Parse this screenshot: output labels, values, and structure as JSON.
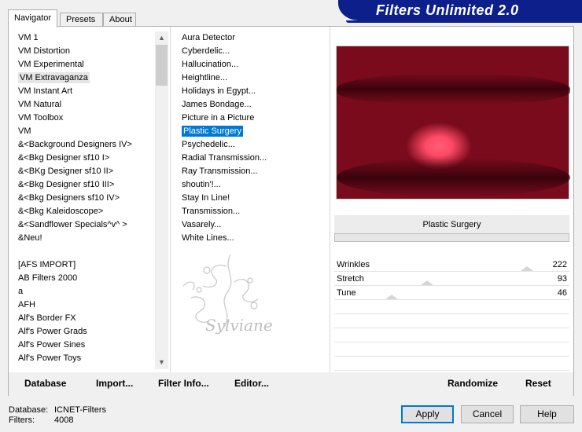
{
  "banner": {
    "title": "Filters Unlimited 2.0"
  },
  "tabs": {
    "navigator": "Navigator",
    "presets": "Presets",
    "about": "About"
  },
  "categories": [
    "VM 1",
    "VM Distortion",
    "VM Experimental",
    "VM Extravaganza",
    "VM Instant Art",
    "VM Natural",
    "VM Toolbox",
    "VM",
    "&<Background Designers IV>",
    "&<Bkg Designer sf10 I>",
    "&<BKg Designer sf10 II>",
    "&<Bkg Designer sf10 III>",
    "&<Bkg Designers sf10 IV>",
    "&<Bkg Kaleidoscope>",
    "&<Sandflower Specials^v^ >",
    "&Neu!",
    "",
    "[AFS IMPORT]",
    "AB Filters 2000",
    "a",
    "AFH",
    "Alf's Border FX",
    "Alf's Power Grads",
    "Alf's Power Sines",
    "Alf's Power Toys"
  ],
  "selected_category": "VM Extravaganza",
  "filters": [
    "Aura Detector",
    "Cyberdelic...",
    "Hallucination...",
    "Heightline...",
    "Holidays in Egypt...",
    "James Bondage...",
    "Picture in a Picture",
    "Plastic Surgery",
    "Psychedelic...",
    "Radial Transmission...",
    "Ray Transmission...",
    "shoutin'!...",
    "Stay In Line!",
    "Transmission...",
    "Vasarely...",
    "White Lines..."
  ],
  "selected_filter": "Plastic Surgery",
  "watermark_text": "Sylviane",
  "filter_panel": {
    "name": "Plastic Surgery",
    "params": [
      {
        "label": "Wrinkles",
        "value": "222",
        "level": 0.87
      },
      {
        "label": "Stretch",
        "value": "93",
        "level": 0.36
      },
      {
        "label": "Tune",
        "value": "46",
        "level": 0.18
      }
    ]
  },
  "bottom_links": {
    "database": "Database",
    "import": "Import...",
    "filter_info": "Filter Info...",
    "editor": "Editor...",
    "randomize": "Randomize",
    "reset": "Reset"
  },
  "status": {
    "database_label": "Database:",
    "database_value": "ICNET-Filters",
    "filters_label": "Filters:",
    "filters_value": "4008"
  },
  "buttons": {
    "apply": "Apply",
    "cancel": "Cancel",
    "help": "Help"
  },
  "colors": {
    "banner": "#0c1f8a",
    "selection": "#0078d7",
    "preview_red": "#e32e4c"
  }
}
